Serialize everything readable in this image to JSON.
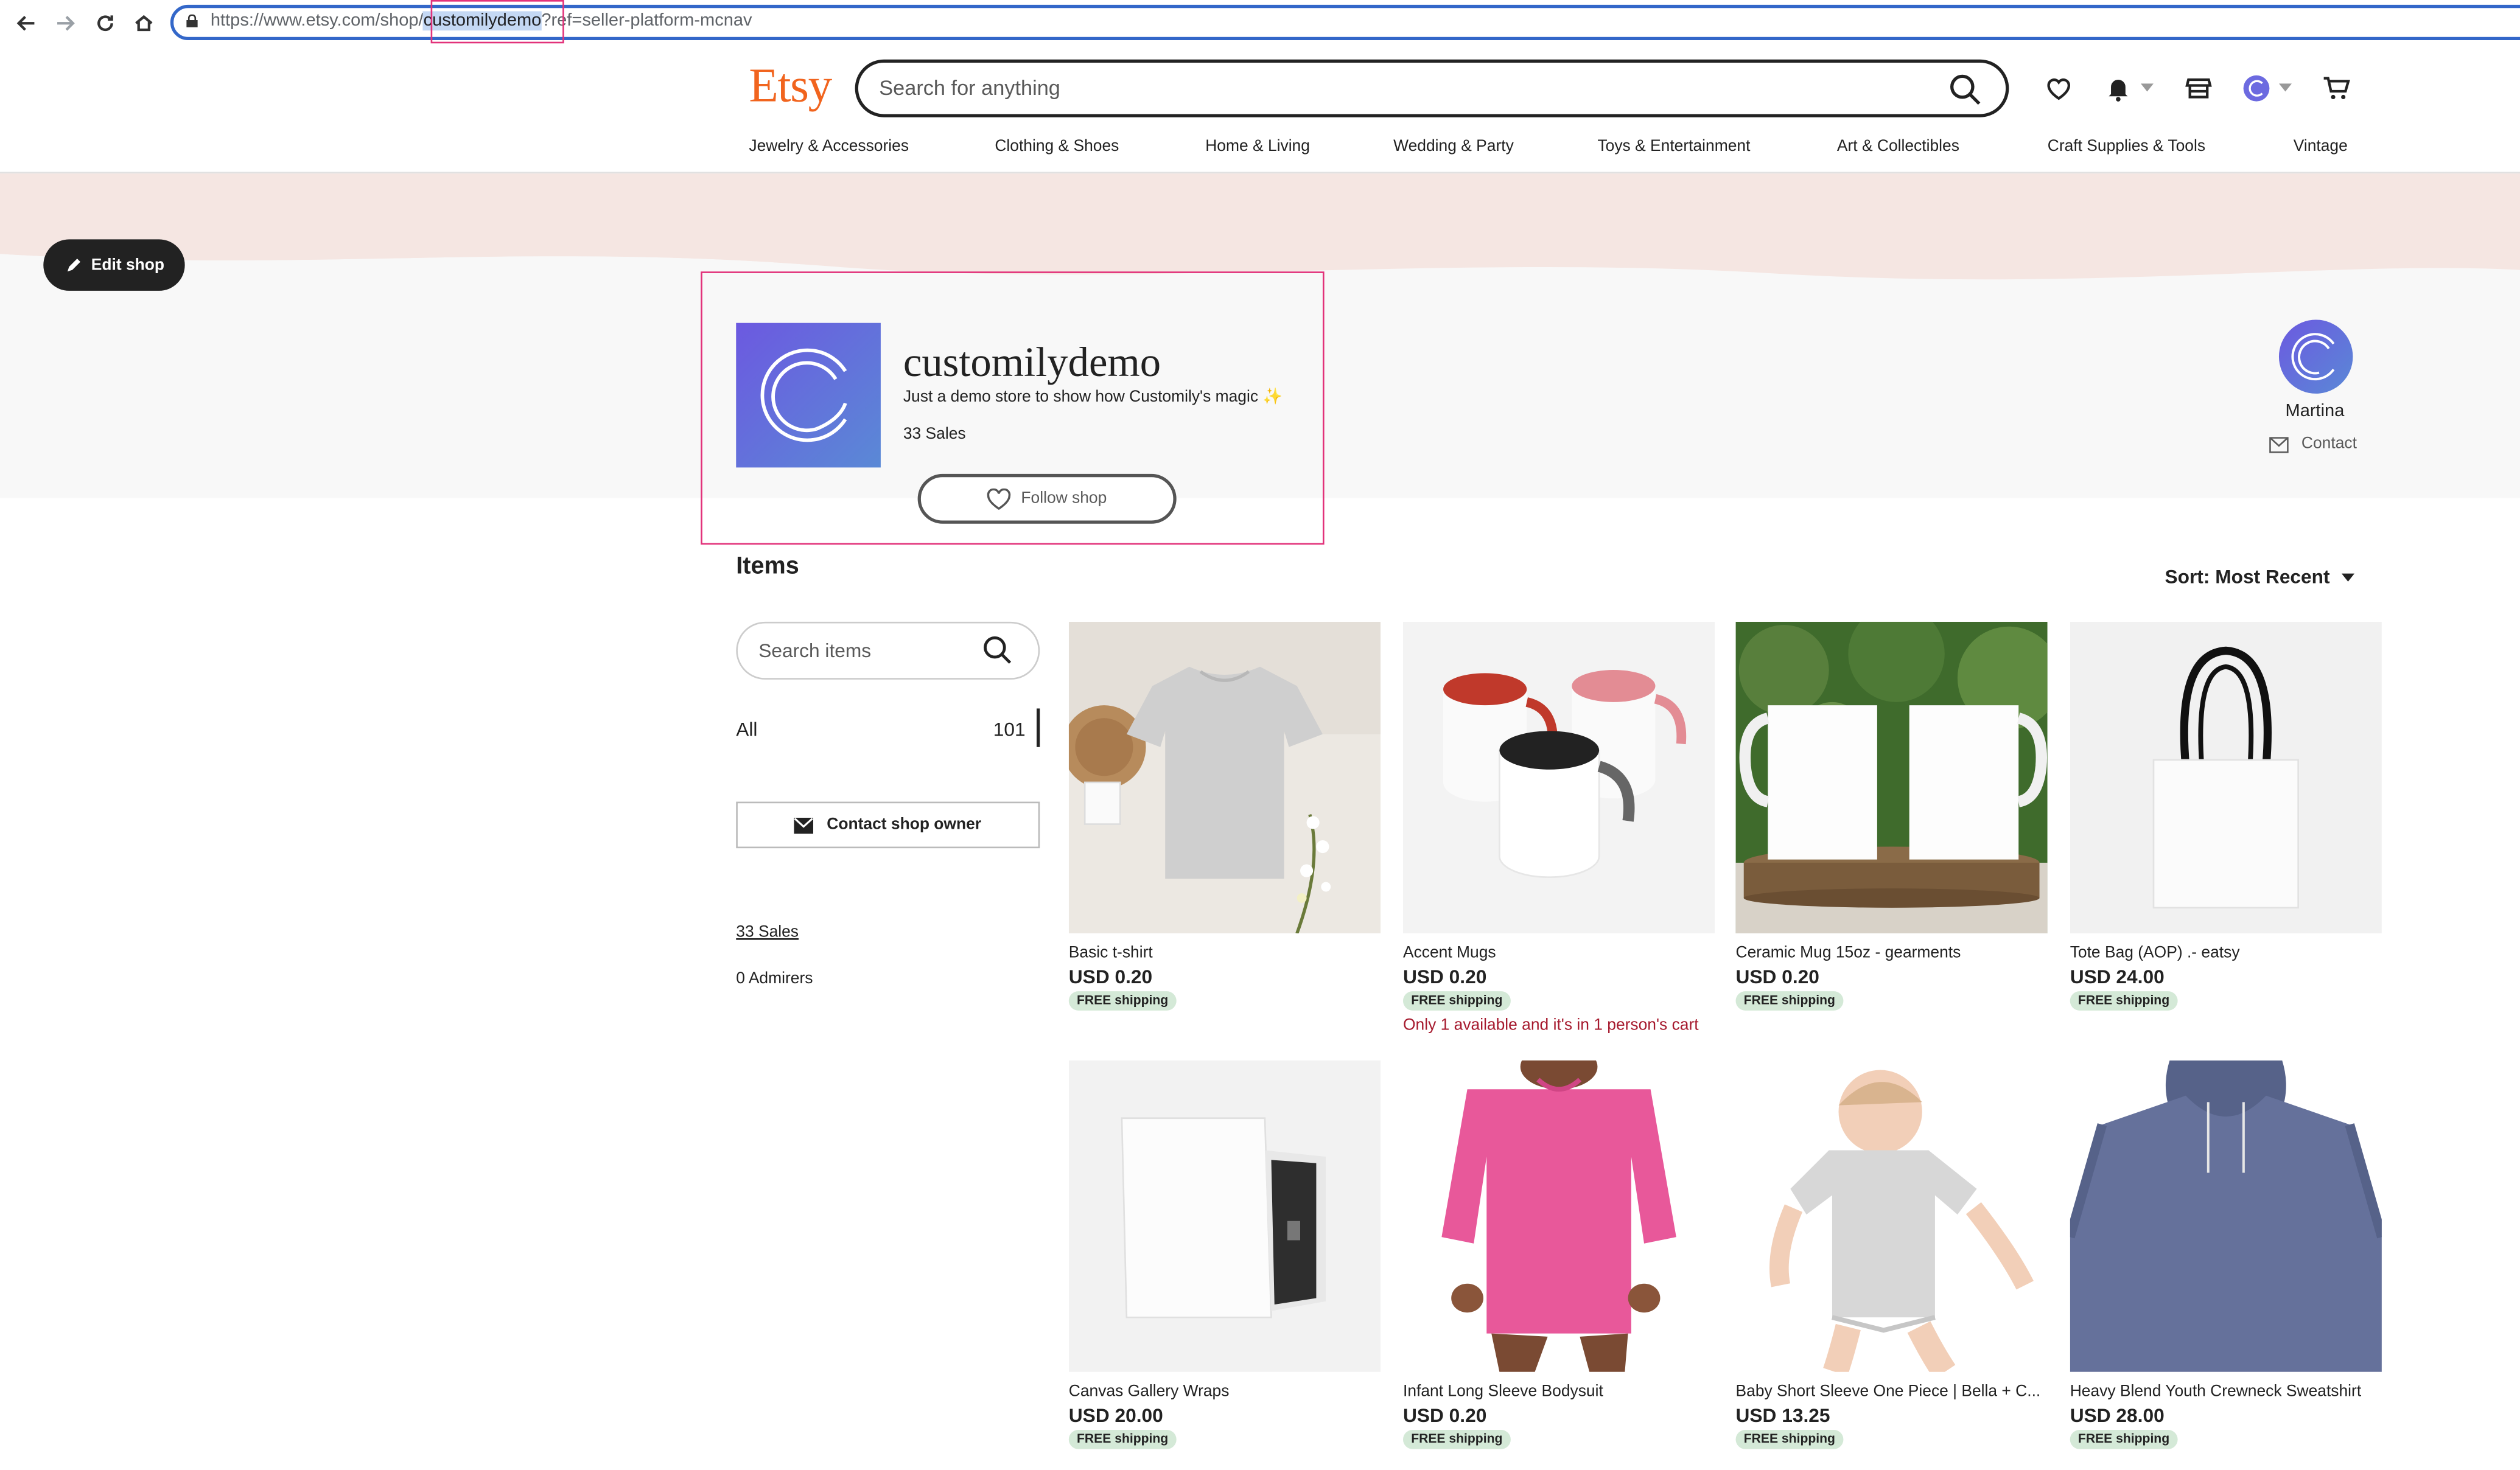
{
  "browser": {
    "url_prefix": "https://www.etsy.com/shop/",
    "url_highlight": "customilydemo",
    "url_suffix": "?ref=seller-platform-mcnav"
  },
  "header": {
    "logo": "Etsy",
    "search_placeholder": "Search for anything",
    "categories": [
      "Jewelry & Accessories",
      "Clothing & Shoes",
      "Home & Living",
      "Wedding & Party",
      "Toys & Entertainment",
      "Art & Collectibles",
      "Craft Supplies & Tools",
      "Vintage"
    ]
  },
  "shop": {
    "edit_label": "Edit shop",
    "name": "customilydemo",
    "tagline": "Just a demo store to show how Customily's magic",
    "tagline_emoji": "✨",
    "sales": "33 Sales",
    "follow_label": "Follow shop",
    "owner_name": "Martina",
    "contact_label": "Contact"
  },
  "items": {
    "title": "Items",
    "sort_label": "Sort: Most Recent",
    "search_placeholder": "Search items",
    "section_all_label": "All",
    "section_all_count": "101",
    "contact_owner_label": "Contact shop owner",
    "sales_link": "33 Sales",
    "admirers": "0 Admirers"
  },
  "products": [
    {
      "title": "Basic t-shirt",
      "price": "USD 0.20",
      "shipping": "FREE shipping",
      "note": ""
    },
    {
      "title": "Accent Mugs",
      "price": "USD 0.20",
      "shipping": "FREE shipping",
      "note": "Only 1 available and it's in 1 person's cart"
    },
    {
      "title": "Ceramic Mug 15oz - gearments",
      "price": "USD 0.20",
      "shipping": "FREE shipping",
      "note": ""
    },
    {
      "title": "Tote Bag (AOP) .- eatsy",
      "price": "USD 24.00",
      "shipping": "FREE shipping",
      "note": ""
    },
    {
      "title": "Canvas Gallery Wraps",
      "price": "USD 20.00",
      "shipping": "FREE shipping",
      "note": ""
    },
    {
      "title": "Infant Long Sleeve Bodysuit",
      "price": "USD 0.20",
      "shipping": "FREE shipping",
      "note": ""
    },
    {
      "title": "Baby Short Sleeve One Piece | Bella + C...",
      "price": "USD 13.25",
      "shipping": "FREE shipping",
      "note": ""
    },
    {
      "title": "Heavy Blend Youth Crewneck Sweatshirt",
      "price": "USD 28.00",
      "shipping": "FREE shipping",
      "note": ""
    }
  ],
  "colors": {
    "brand": "#f1641e",
    "highlight": "#e2327a",
    "banner": "#f5e6e2",
    "shipping_badge": "#d4e9d7",
    "alert_text": "#a61a2e"
  }
}
